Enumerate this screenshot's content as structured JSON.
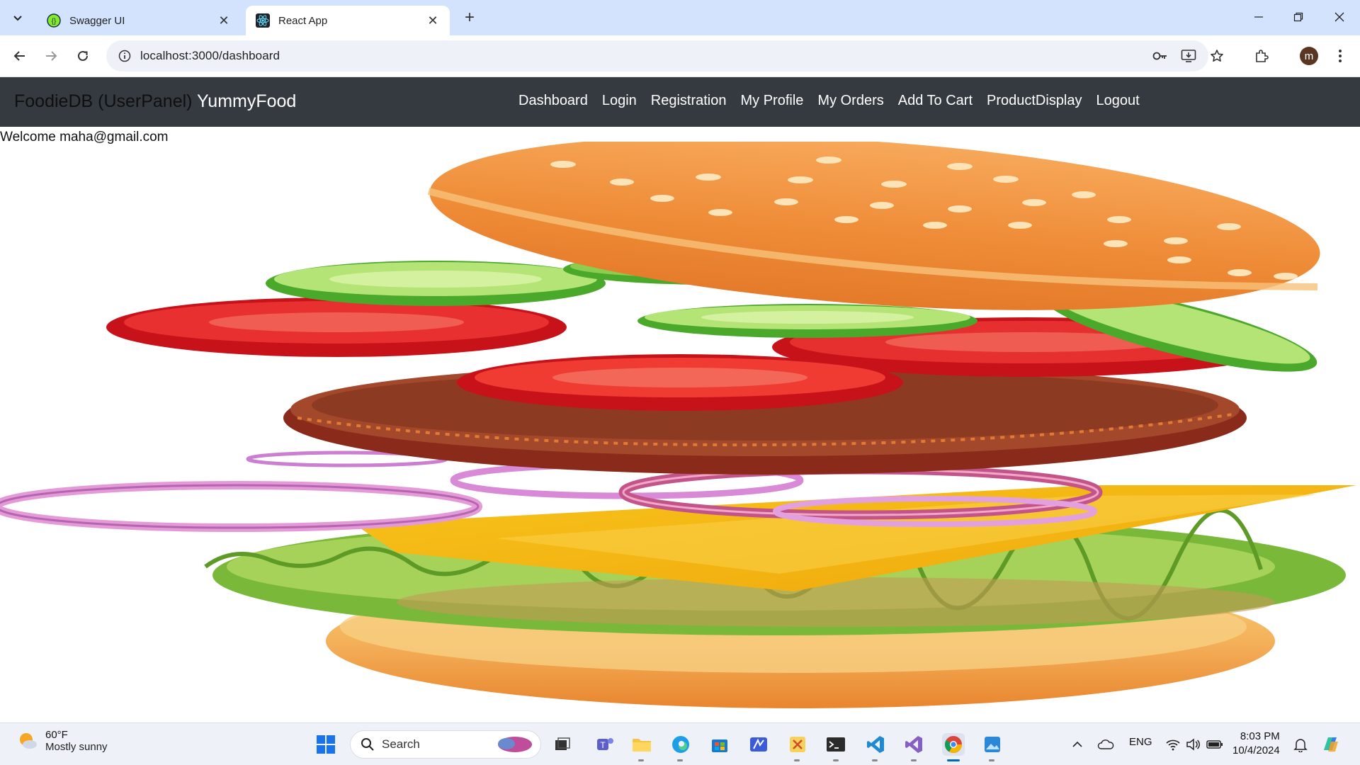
{
  "browser": {
    "tabs": [
      {
        "title": "Swagger UI",
        "active": false,
        "icon": "swagger-icon"
      },
      {
        "title": "React App",
        "active": true,
        "icon": "react-icon"
      }
    ],
    "url": "localhost:3000/dashboard",
    "profile_initial": "m"
  },
  "navbar": {
    "brand_muted": "FoodieDB (UserPanel)",
    "brand": "YummyFood",
    "links": [
      "Dashboard",
      "Login",
      "Registration",
      "My Profile",
      "My Orders",
      "Add To Cart",
      "ProductDisplay",
      "Logout"
    ],
    "background": "#343a40"
  },
  "page": {
    "welcome": "Welcome maha@gmail.com",
    "hero_image": "exploded-burger-illustration"
  },
  "taskbar": {
    "weather": {
      "temp": "60°F",
      "condition": "Mostly sunny"
    },
    "search_placeholder": "Search",
    "language": "ENG",
    "time": "8:03 PM",
    "date": "10/4/2024"
  }
}
